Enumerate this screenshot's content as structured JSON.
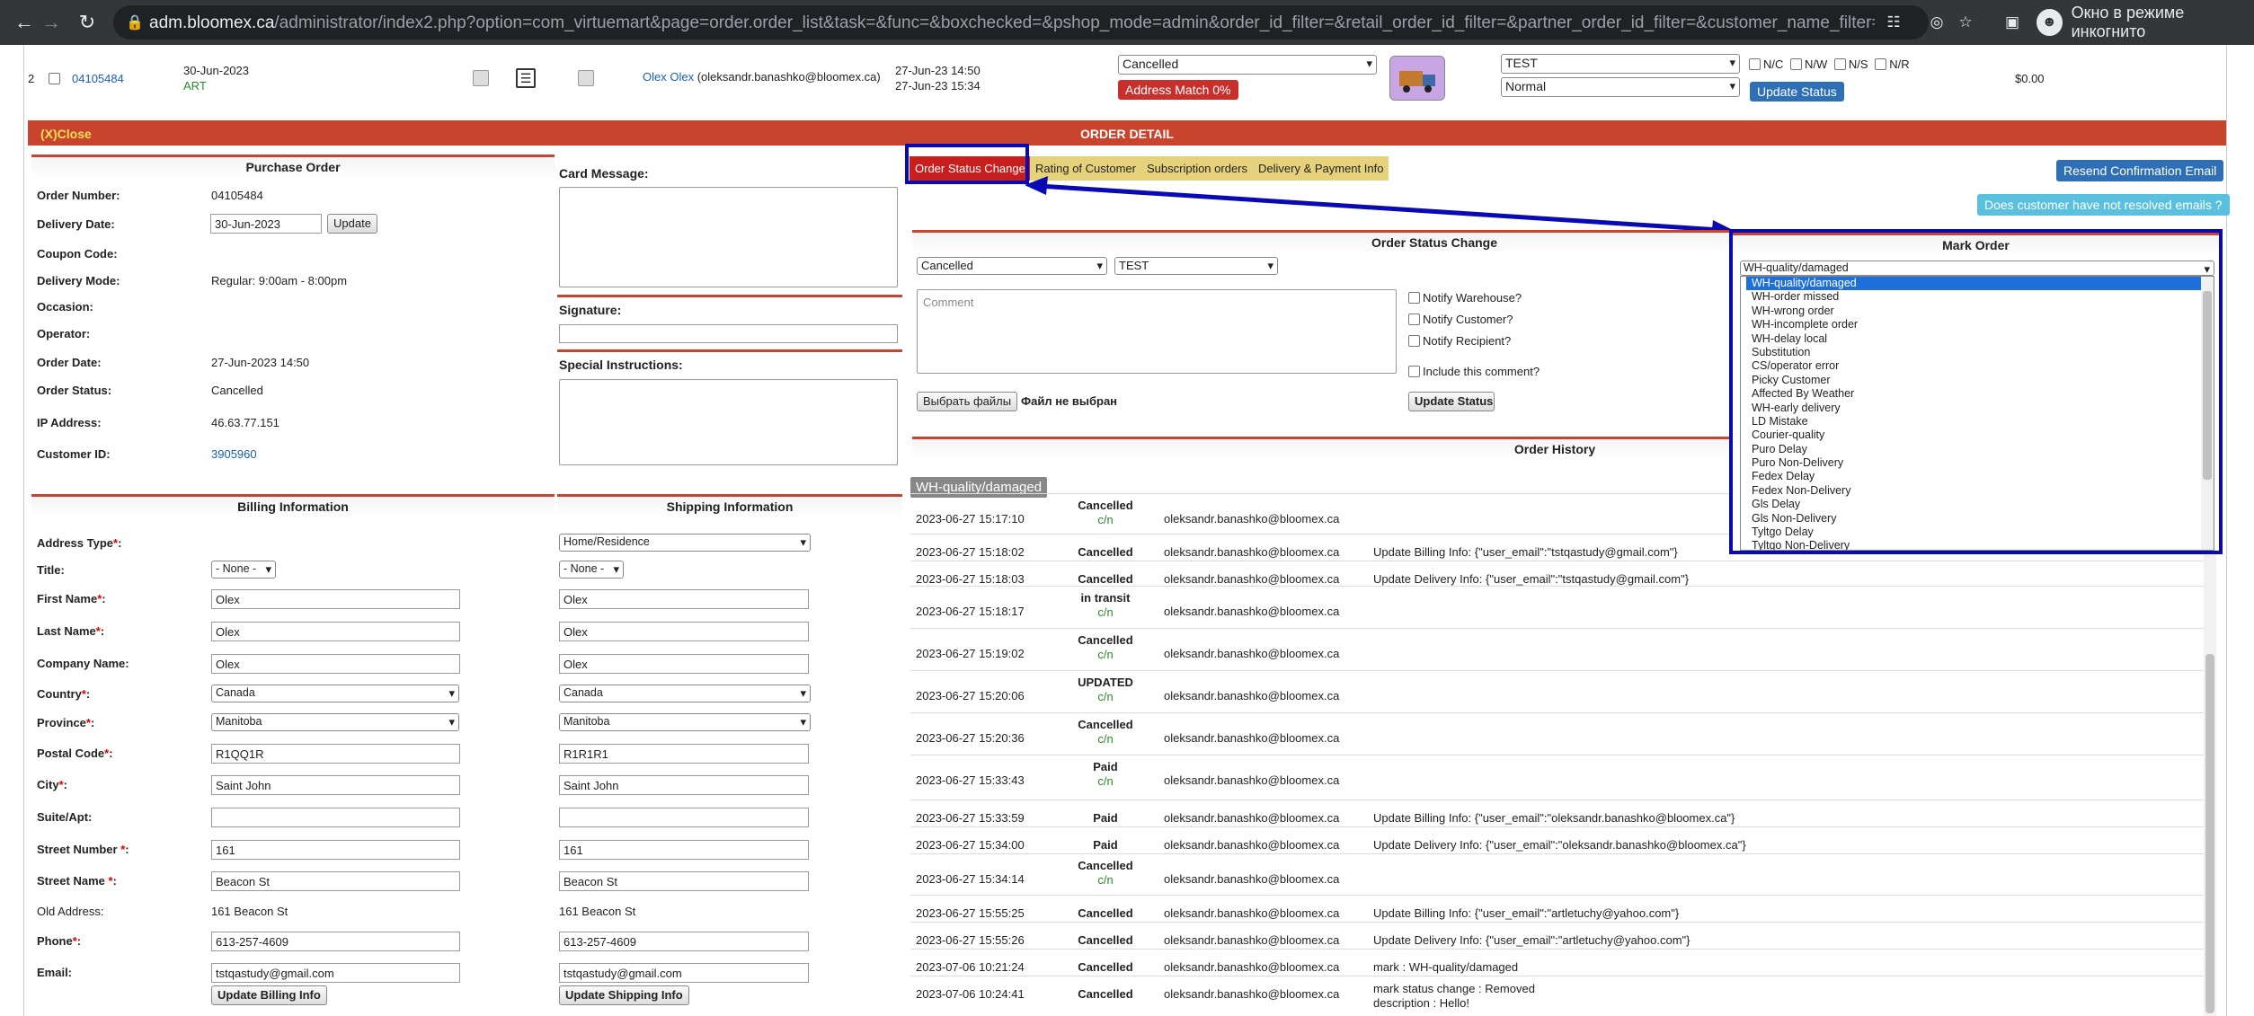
{
  "browser": {
    "url_host": "adm.bloomex.ca",
    "url_path": "/administrator/index2.php?option=com_virtuemart&page=order.order_list&task=&func=&boxchecked=&pshop_mode=admin&order_id_filter=&retail_order_id_filter=&partner_order_id_filter=&customer_name_filter=&user_email...",
    "incognito_label": "Окно в режиме инкогнито"
  },
  "order_row": {
    "index": "2",
    "order_id": "04105484",
    "date": "30-Jun-2023",
    "type": "ART",
    "customer_name": "Olex Olex",
    "customer_email": "(oleksandr.banashko@bloomex.ca)",
    "created": "27-Jun-23 14:50",
    "modified": "27-Jun-23 15:34",
    "status": "Cancelled",
    "address_match": "Address Match 0%",
    "warehouse": "TEST",
    "priority": "Normal",
    "flags": [
      "N/C",
      "N/W",
      "N/S",
      "N/R"
    ],
    "update_status": "Update Status",
    "amount": "$0.00"
  },
  "detail": {
    "close": "(X)Close",
    "title": "ORDER DETAIL"
  },
  "purchase": {
    "title": "Purchase Order",
    "labels": {
      "number": "Order Number:",
      "delivery": "Delivery Date:",
      "coupon": "Coupon Code:",
      "mode": "Delivery Mode:",
      "occasion": "Occasion:",
      "operator": "Operator:",
      "date": "Order Date:",
      "status": "Order Status:",
      "ip": "IP Address:",
      "customer": "Customer ID:"
    },
    "values": {
      "number": "04105484",
      "delivery": "30-Jun-2023",
      "update": "Update",
      "mode": "Regular: 9:00am - 8:00pm",
      "date": "27-Jun-2023 14:50",
      "status": "Cancelled",
      "ip": "46.63.77.151",
      "customer": "3905960"
    }
  },
  "card": {
    "message": "Card Message:",
    "signature": "Signature:",
    "special": "Special Instructions:"
  },
  "tabs": [
    "Order Status Change",
    "Rating of Customer",
    "Subscription orders",
    "Delivery & Payment Info"
  ],
  "right_buttons": {
    "resend": "Resend Confirmation Email",
    "unresolved": "Does customer have not resolved emails ?"
  },
  "status_change": {
    "title": "Order Status Change",
    "status": "Cancelled",
    "warehouse": "TEST",
    "comment_placeholder": "Comment",
    "notify": [
      "Notify Warehouse?",
      "Notify Customer?",
      "Notify Recipient?"
    ],
    "include": "Include this comment?",
    "choose_files": "Выбрать файлы",
    "no_file": "Файл не выбран",
    "update": "Update Status"
  },
  "mark_order": {
    "title": "Mark Order",
    "selected": "WH-quality/damaged",
    "options": [
      "WH-quality/damaged",
      "WH-order missed",
      "WH-wrong order",
      "WH-incomplete order",
      "WH-delay local",
      "Substitution",
      "CS/operator error",
      "Picky Customer",
      "Affected By Weather",
      "WH-early delivery",
      "LD Mistake",
      "Courier-quality",
      "Puro Delay",
      "Puro Non-Delivery",
      "Fedex Delay",
      "Fedex Non-Delivery",
      "Gls Delay",
      "Gls Non-Delivery",
      "Tyltgo Delay",
      "Tyltgo Non-Delivery"
    ]
  },
  "history": {
    "title": "Order History",
    "badge": "WH-quality/damaged",
    "rows": [
      {
        "date": "2023-06-27 15:17:10",
        "status": "Cancelled",
        "sub": "c/n",
        "user": "oleksandr.banashko@bloomex.ca",
        "note": ""
      },
      {
        "date": "2023-06-27 15:18:02",
        "status": "Cancelled",
        "sub": "",
        "user": "oleksandr.banashko@bloomex.ca",
        "note": "Update Billing Info: {\"user_email\":\"tstqastudy@gmail.com\"}"
      },
      {
        "date": "2023-06-27 15:18:03",
        "status": "Cancelled",
        "sub": "",
        "user": "oleksandr.banashko@bloomex.ca",
        "note": "Update Delivery Info: {\"user_email\":\"tstqastudy@gmail.com\"}"
      },
      {
        "date": "2023-06-27 15:18:17",
        "status": "in transit",
        "sub": "c/n",
        "user": "oleksandr.banashko@bloomex.ca",
        "note": ""
      },
      {
        "date": "2023-06-27 15:19:02",
        "status": "Cancelled",
        "sub": "c/n",
        "user": "oleksandr.banashko@bloomex.ca",
        "note": ""
      },
      {
        "date": "2023-06-27 15:20:06",
        "status": "UPDATED",
        "sub": "c/n",
        "user": "oleksandr.banashko@bloomex.ca",
        "note": ""
      },
      {
        "date": "2023-06-27 15:20:36",
        "status": "Cancelled",
        "sub": "c/n",
        "user": "oleksandr.banashko@bloomex.ca",
        "note": ""
      },
      {
        "date": "2023-06-27 15:33:43",
        "status": "Paid",
        "sub": "c/n",
        "user": "oleksandr.banashko@bloomex.ca",
        "note": ""
      },
      {
        "date": "2023-06-27 15:33:59",
        "status": "Paid",
        "sub": "",
        "user": "oleksandr.banashko@bloomex.ca",
        "note": "Update Billing Info: {\"user_email\":\"oleksandr.banashko@bloomex.ca\"}"
      },
      {
        "date": "2023-06-27 15:34:00",
        "status": "Paid",
        "sub": "",
        "user": "oleksandr.banashko@bloomex.ca",
        "note": "Update Delivery Info: {\"user_email\":\"oleksandr.banashko@bloomex.ca\"}"
      },
      {
        "date": "2023-06-27 15:34:14",
        "status": "Cancelled",
        "sub": "c/n",
        "user": "oleksandr.banashko@bloomex.ca",
        "note": ""
      },
      {
        "date": "2023-06-27 15:55:25",
        "status": "Cancelled",
        "sub": "",
        "user": "oleksandr.banashko@bloomex.ca",
        "note": "Update Billing Info: {\"user_email\":\"artletuchy@yahoo.com\"}"
      },
      {
        "date": "2023-06-27 15:55:26",
        "status": "Cancelled",
        "sub": "",
        "user": "oleksandr.banashko@bloomex.ca",
        "note": "Update Delivery Info: {\"user_email\":\"artletuchy@yahoo.com\"}"
      },
      {
        "date": "2023-07-06 10:21:24",
        "status": "Cancelled",
        "sub": "",
        "user": "oleksandr.banashko@bloomex.ca",
        "note": "mark : WH-quality/damaged"
      },
      {
        "date": "2023-07-06 10:24:41",
        "status": "Cancelled",
        "sub": "",
        "user": "oleksandr.banashko@bloomex.ca",
        "note": "mark status change : Removed",
        "note2": "description : Hello!"
      }
    ]
  },
  "billing": {
    "title": "Billing Information",
    "shipping_title": "Shipping Information",
    "labels": [
      "Address Type",
      "Title:",
      "First Name",
      "Last Name",
      "Company Name:",
      "Country",
      "Province",
      "Postal Code",
      "City",
      "Suite/Apt:",
      "Street Number ",
      "Street Name ",
      "Old Address:",
      "Phone",
      "Email:"
    ],
    "billing_values": [
      "",
      "- None -",
      "Olex",
      "Olex",
      "Olex",
      "Canada",
      "Manitoba",
      "R1QQ1R",
      "Saint John",
      "",
      "161",
      "Beacon St",
      "161 Beacon St",
      "613-257-4609",
      "tstqastudy@gmail.com"
    ],
    "shipping_values": [
      "Home/Residence",
      "- None -",
      "Olex",
      "Olex",
      "Olex",
      "Canada",
      "Manitoba",
      "R1R1R1",
      "Saint John",
      "",
      "161",
      "Beacon St",
      "161 Beacon St",
      "613-257-4609",
      "tstqastudy@gmail.com"
    ],
    "update_billing": "Update Billing Info",
    "update_shipping": "Update Shipping Info"
  },
  "colors": {
    "accent": "#c8442c",
    "highlight": "#0a0ab4",
    "blue_button": "#2e6fb6",
    "tab": "#e7d27c"
  }
}
